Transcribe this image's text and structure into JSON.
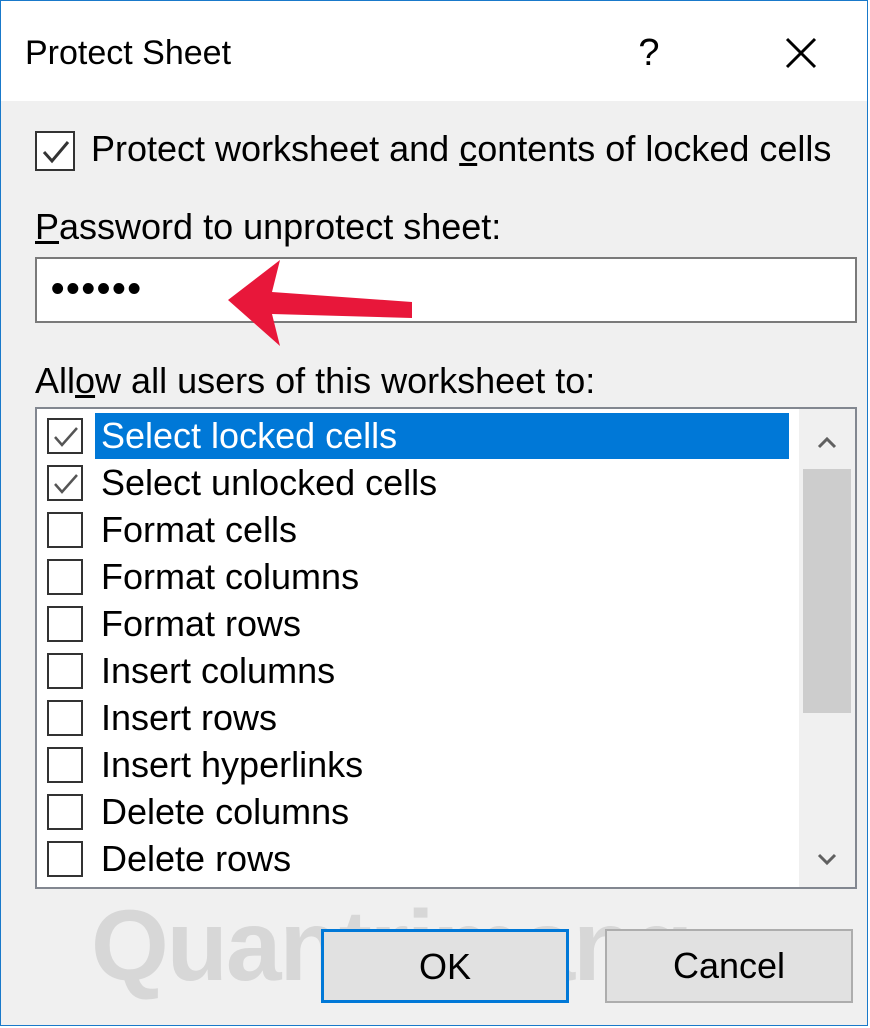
{
  "dialog": {
    "title": "Protect Sheet",
    "help_label": "?"
  },
  "protect": {
    "label_pre": "Protect worksheet and ",
    "label_underline": "c",
    "label_post": "ontents of locked cells",
    "checked": true
  },
  "password": {
    "label_underline": "P",
    "label_rest": "assword to unprotect sheet:",
    "value": "••••••"
  },
  "allow": {
    "label_pre": "All",
    "label_underline": "o",
    "label_post": "w all users of this worksheet to:"
  },
  "permissions": [
    {
      "label": "Select locked cells",
      "checked": true,
      "selected": true
    },
    {
      "label": "Select unlocked cells",
      "checked": true,
      "selected": false
    },
    {
      "label": "Format cells",
      "checked": false,
      "selected": false
    },
    {
      "label": "Format columns",
      "checked": false,
      "selected": false
    },
    {
      "label": "Format rows",
      "checked": false,
      "selected": false
    },
    {
      "label": "Insert columns",
      "checked": false,
      "selected": false
    },
    {
      "label": "Insert rows",
      "checked": false,
      "selected": false
    },
    {
      "label": "Insert hyperlinks",
      "checked": false,
      "selected": false
    },
    {
      "label": "Delete columns",
      "checked": false,
      "selected": false
    },
    {
      "label": "Delete rows",
      "checked": false,
      "selected": false
    }
  ],
  "buttons": {
    "ok": "OK",
    "cancel": "Cancel"
  },
  "watermark": "Quantrimang",
  "colors": {
    "accent": "#0078d7",
    "annotation_arrow": "#e8173a"
  }
}
